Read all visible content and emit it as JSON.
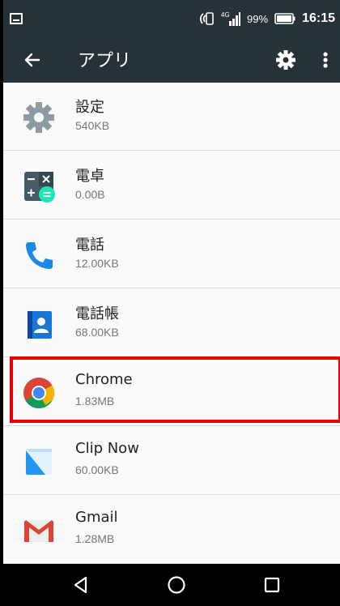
{
  "status_bar": {
    "battery_percent": "99%",
    "network": "4G",
    "time": "16:15"
  },
  "app_bar": {
    "title": "アプリ",
    "back_icon": "arrow-back-icon",
    "settings_icon": "gear-icon",
    "overflow_icon": "more-vert-icon"
  },
  "apps": [
    {
      "name": "設定",
      "size": "540KB",
      "icon": "settings-gear-icon"
    },
    {
      "name": "電卓",
      "size": "0.00B",
      "icon": "calculator-icon"
    },
    {
      "name": "電話",
      "size": "12.00KB",
      "icon": "phone-icon"
    },
    {
      "name": "電話帳",
      "size": "68.00KB",
      "icon": "contacts-icon"
    },
    {
      "name": "Chrome",
      "size": "1.83MB",
      "icon": "chrome-icon"
    },
    {
      "name": "Clip Now",
      "size": "60.00KB",
      "icon": "clip-now-icon"
    },
    {
      "name": "Gmail",
      "size": "1.28MB",
      "icon": "gmail-icon"
    }
  ],
  "highlight": {
    "target": "Chrome",
    "color": "#e60000"
  },
  "nav_bar": {
    "back_icon": "nav-back-icon",
    "home_icon": "nav-home-icon",
    "recents_icon": "nav-recents-icon"
  },
  "colors": {
    "toolbar": "#263238",
    "background": "#fafafa",
    "primary_text": "#212121",
    "secondary_text": "#757575"
  }
}
